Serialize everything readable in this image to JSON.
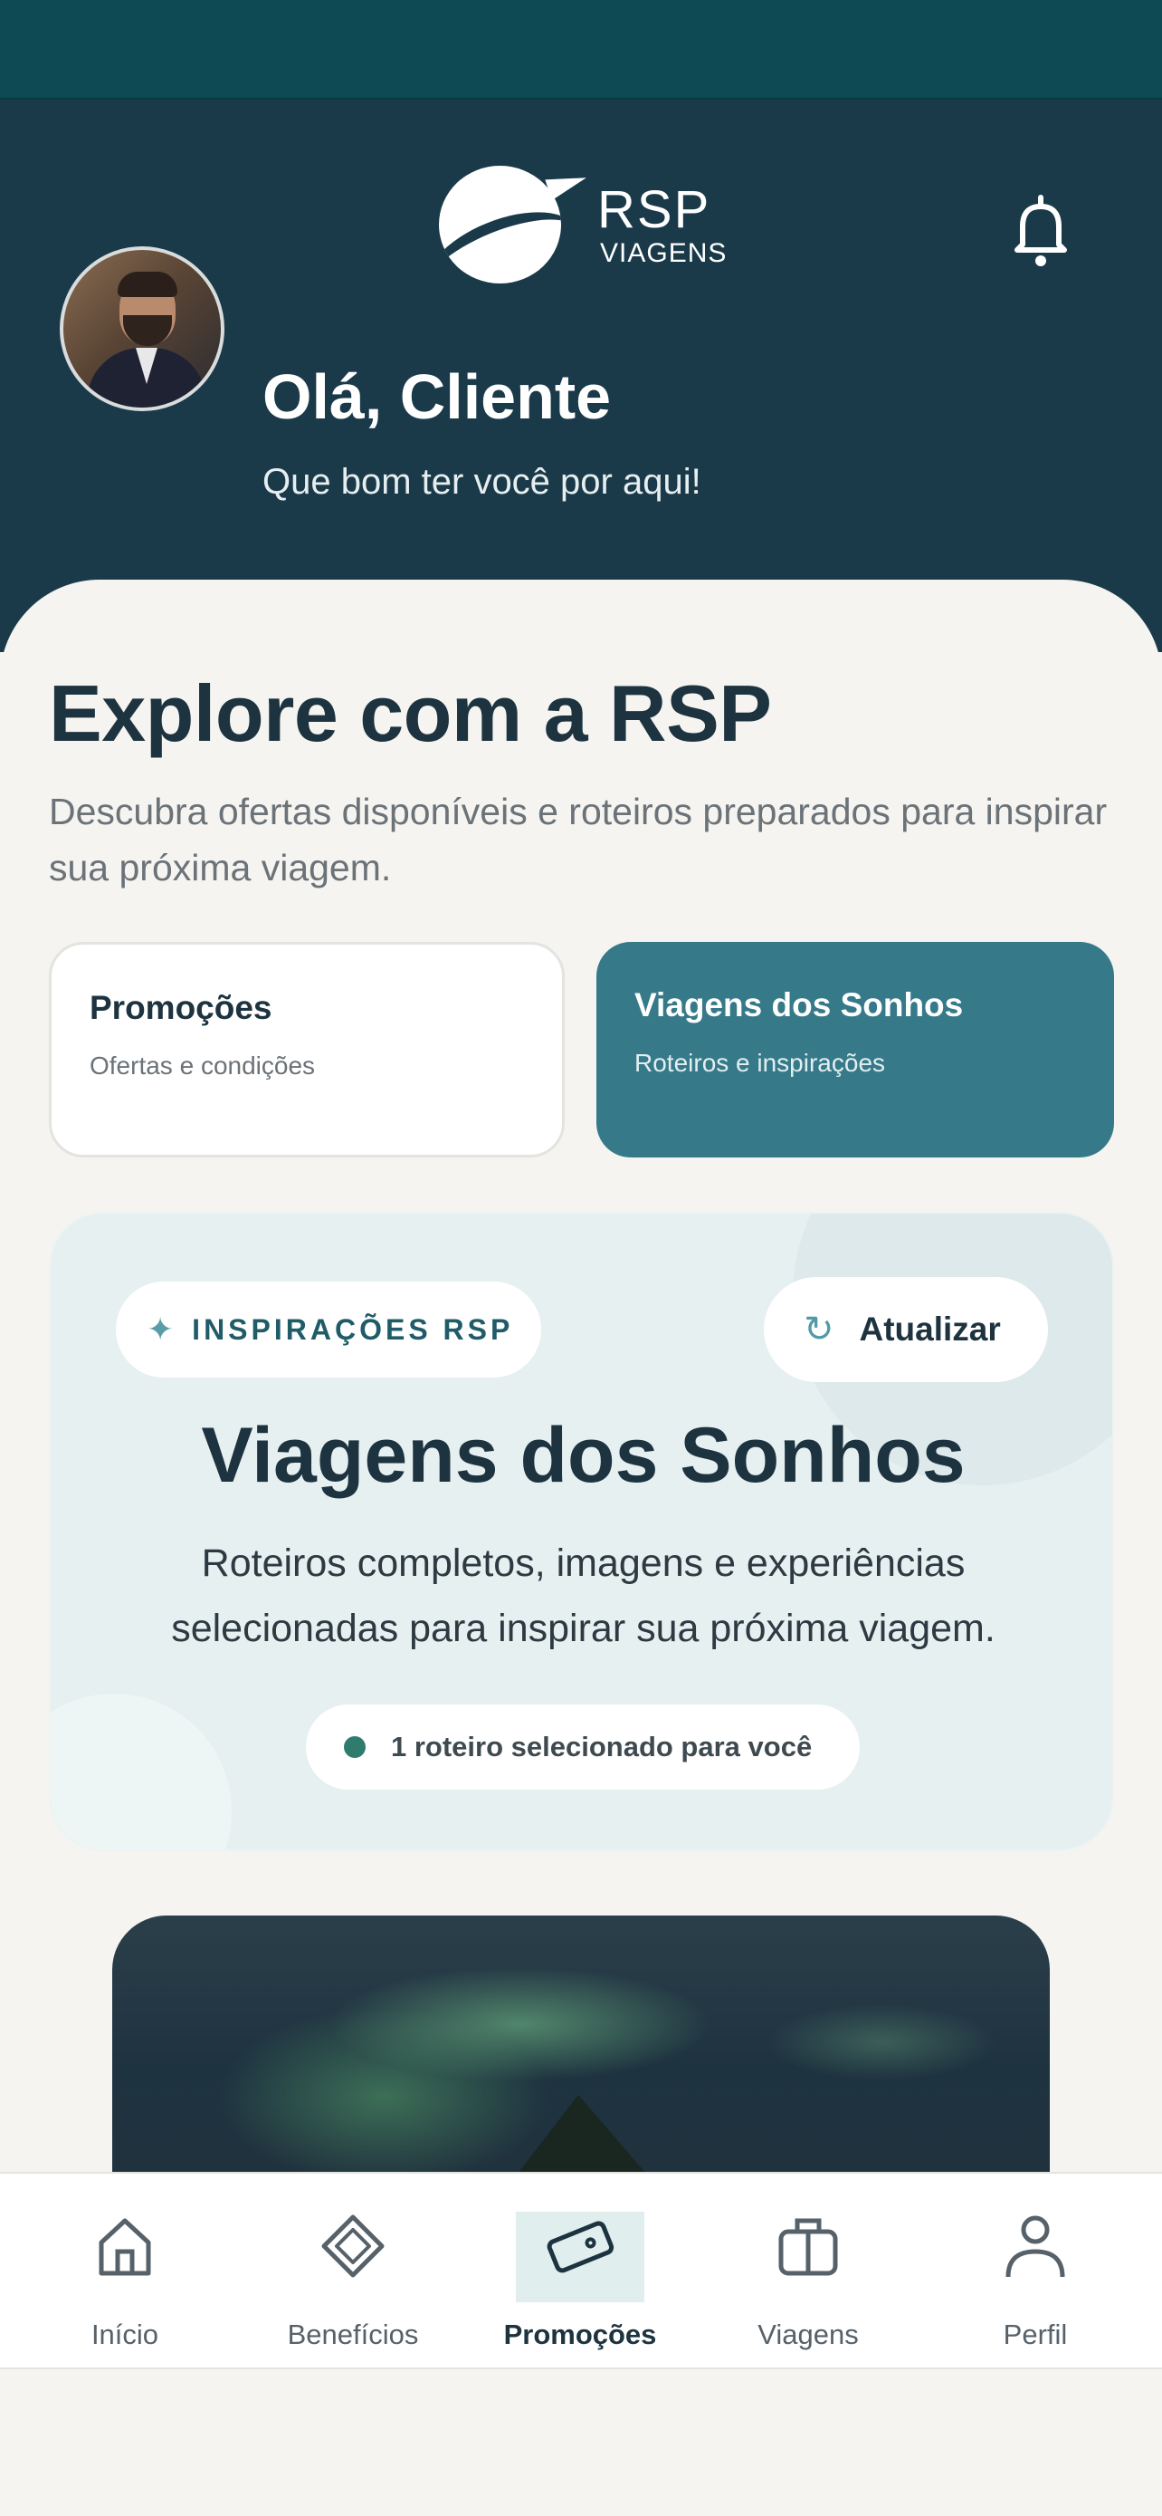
{
  "colors": {
    "status_bar": "#0d4a54",
    "header_bg": "#1a3a4a",
    "page_bg": "#f5f4f0",
    "accent": "#367a8a",
    "hero_bg": "#e6f0f1",
    "nav_active_bg": "#e0eeee",
    "count_dot": "#2f7b6c"
  },
  "header": {
    "logo": {
      "name": "RSP",
      "sub": "VIAGENS"
    },
    "notification_icon": "bell-icon",
    "greeting": "Olá, Cliente",
    "subgreeting": "Que bom ter você por aqui!"
  },
  "main": {
    "title": "Explore com a RSP",
    "description": "Descubra ofertas disponíveis e roteiros preparados para inspirar sua próxima viagem.",
    "tabs": [
      {
        "title": "Promoções",
        "subtitle": "Ofertas e condições",
        "active": false
      },
      {
        "title": "Viagens dos Sonhos",
        "subtitle": "Roteiros e inspirações",
        "active": true
      }
    ],
    "hero": {
      "badge_icon": "sparkle-icon",
      "badge": "INSPIRAÇÕES RSP",
      "refresh_icon": "refresh-icon",
      "refresh_label": "Atualizar",
      "title": "Viagens dos Sonhos",
      "description": "Roteiros completos, imagens e experiências selecionadas para inspirar sua próxima viagem.",
      "count_label": "1 roteiro selecionado para você"
    }
  },
  "nav": {
    "items": [
      {
        "label": "Início",
        "icon": "home-icon",
        "active": false
      },
      {
        "label": "Benefícios",
        "icon": "diamond-icon",
        "active": false
      },
      {
        "label": "Promoções",
        "icon": "ticket-icon",
        "active": true
      },
      {
        "label": "Viagens",
        "icon": "suitcase-icon",
        "active": false
      },
      {
        "label": "Perfil",
        "icon": "user-icon",
        "active": false
      }
    ]
  }
}
